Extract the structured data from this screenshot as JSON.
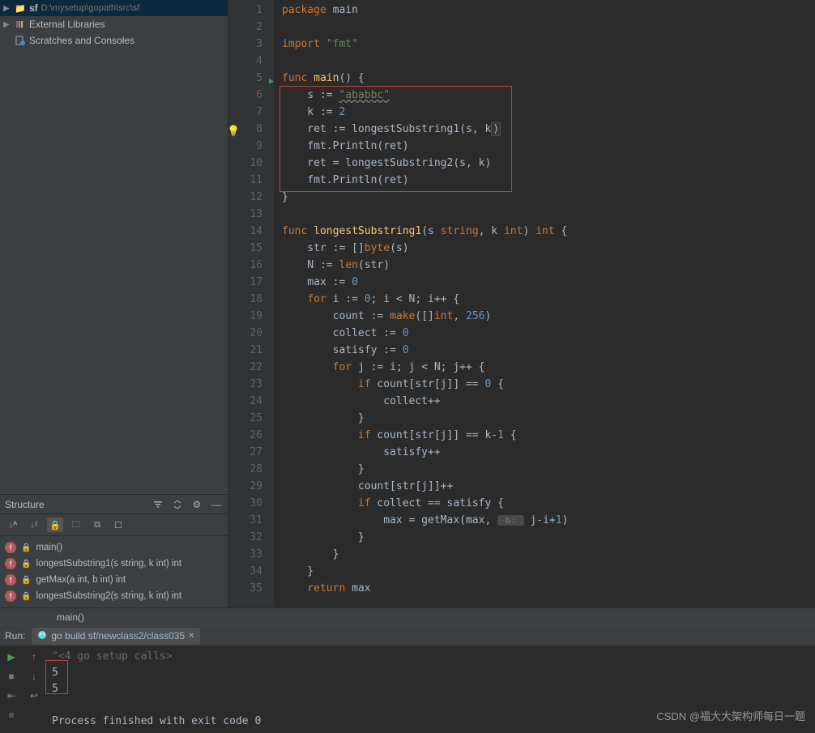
{
  "project": {
    "root_name": "sf",
    "root_path": "D:\\mysetup\\gopath\\src\\sf",
    "external_libs": "External Libraries",
    "scratches": "Scratches and Consoles"
  },
  "structure": {
    "title": "Structure",
    "items": [
      {
        "icon": "f",
        "label": "main()"
      },
      {
        "icon": "f",
        "label": "longestSubstring1(s string, k int) int"
      },
      {
        "icon": "f",
        "label": "getMax(a int, b int) int"
      },
      {
        "icon": "f",
        "label": "longestSubstring2(s string, k int) int"
      }
    ]
  },
  "code": {
    "lines": [
      {
        "n": 1,
        "seg": [
          {
            "t": "package ",
            "c": "kw"
          },
          {
            "t": "main",
            "c": "ident"
          }
        ]
      },
      {
        "n": 2,
        "seg": []
      },
      {
        "n": 3,
        "seg": [
          {
            "t": "import ",
            "c": "kw"
          },
          {
            "t": "\"fmt\"",
            "c": "str"
          }
        ]
      },
      {
        "n": 4,
        "seg": []
      },
      {
        "n": 5,
        "run": true,
        "seg": [
          {
            "t": "func ",
            "c": "kw"
          },
          {
            "t": "main",
            "c": "fn"
          },
          {
            "t": "() {",
            "c": "ident"
          }
        ]
      },
      {
        "n": 6,
        "seg": [
          {
            "t": "    s := ",
            "c": "ident"
          },
          {
            "t": "\"ababbc\"",
            "c": "str underline-wavy"
          }
        ]
      },
      {
        "n": 7,
        "seg": [
          {
            "t": "    k := ",
            "c": "ident"
          },
          {
            "t": "2",
            "c": "num"
          }
        ]
      },
      {
        "n": 8,
        "bulb": true,
        "seg": [
          {
            "t": "    ret := ",
            "c": "ident"
          },
          {
            "t": "longestSubstring1(s, k",
            "c": "ident"
          },
          {
            "t": ")",
            "c": "ident caret-bg"
          }
        ]
      },
      {
        "n": 9,
        "seg": [
          {
            "t": "    fmt.",
            "c": "ident"
          },
          {
            "t": "Println",
            "c": "ident"
          },
          {
            "t": "(ret)",
            "c": "ident"
          }
        ]
      },
      {
        "n": 10,
        "seg": [
          {
            "t": "    ret = longestSubstring2(s, k)",
            "c": "ident"
          }
        ]
      },
      {
        "n": 11,
        "seg": [
          {
            "t": "    fmt.",
            "c": "ident"
          },
          {
            "t": "Println",
            "c": "ident"
          },
          {
            "t": "(ret)",
            "c": "ident"
          }
        ]
      },
      {
        "n": 12,
        "seg": [
          {
            "t": "}",
            "c": "ident"
          }
        ]
      },
      {
        "n": 13,
        "seg": []
      },
      {
        "n": 14,
        "seg": [
          {
            "t": "func ",
            "c": "kw"
          },
          {
            "t": "longestSubstring1",
            "c": "fn"
          },
          {
            "t": "(s ",
            "c": "ident"
          },
          {
            "t": "string",
            "c": "kw"
          },
          {
            "t": ", k ",
            "c": "ident"
          },
          {
            "t": "int",
            "c": "kw"
          },
          {
            "t": ") ",
            "c": "ident"
          },
          {
            "t": "int",
            "c": "kw"
          },
          {
            "t": " {",
            "c": "ident"
          }
        ]
      },
      {
        "n": 15,
        "seg": [
          {
            "t": "    str := []",
            "c": "ident"
          },
          {
            "t": "byte",
            "c": "kw"
          },
          {
            "t": "(s)",
            "c": "ident"
          }
        ]
      },
      {
        "n": 16,
        "seg": [
          {
            "t": "    N := ",
            "c": "ident"
          },
          {
            "t": "len",
            "c": "kw"
          },
          {
            "t": "(str)",
            "c": "ident"
          }
        ]
      },
      {
        "n": 17,
        "seg": [
          {
            "t": "    max := ",
            "c": "ident"
          },
          {
            "t": "0",
            "c": "num"
          }
        ]
      },
      {
        "n": 18,
        "seg": [
          {
            "t": "    ",
            "c": "ident"
          },
          {
            "t": "for ",
            "c": "kw"
          },
          {
            "t": "i := ",
            "c": "ident"
          },
          {
            "t": "0",
            "c": "num"
          },
          {
            "t": "; i < N; i++ {",
            "c": "ident"
          }
        ]
      },
      {
        "n": 19,
        "seg": [
          {
            "t": "        count := ",
            "c": "ident"
          },
          {
            "t": "make",
            "c": "kw"
          },
          {
            "t": "([]",
            "c": "ident"
          },
          {
            "t": "int",
            "c": "kw"
          },
          {
            "t": ", ",
            "c": "ident"
          },
          {
            "t": "256",
            "c": "num"
          },
          {
            "t": ")",
            "c": "ident"
          }
        ]
      },
      {
        "n": 20,
        "seg": [
          {
            "t": "        collect := ",
            "c": "ident"
          },
          {
            "t": "0",
            "c": "num"
          }
        ]
      },
      {
        "n": 21,
        "seg": [
          {
            "t": "        satisfy := ",
            "c": "ident"
          },
          {
            "t": "0",
            "c": "num"
          }
        ]
      },
      {
        "n": 22,
        "seg": [
          {
            "t": "        ",
            "c": "ident"
          },
          {
            "t": "for ",
            "c": "kw"
          },
          {
            "t": "j := i; j < N; j++ {",
            "c": "ident"
          }
        ]
      },
      {
        "n": 23,
        "seg": [
          {
            "t": "            ",
            "c": "ident"
          },
          {
            "t": "if ",
            "c": "kw"
          },
          {
            "t": "count[str[j]] == ",
            "c": "ident"
          },
          {
            "t": "0",
            "c": "num"
          },
          {
            "t": " {",
            "c": "ident"
          }
        ]
      },
      {
        "n": 24,
        "seg": [
          {
            "t": "                collect++",
            "c": "ident"
          }
        ]
      },
      {
        "n": 25,
        "seg": [
          {
            "t": "            }",
            "c": "ident"
          }
        ]
      },
      {
        "n": 26,
        "seg": [
          {
            "t": "            ",
            "c": "ident"
          },
          {
            "t": "if ",
            "c": "kw"
          },
          {
            "t": "count[str[j]] == k-",
            "c": "ident"
          },
          {
            "t": "1",
            "c": "num"
          },
          {
            "t": " {",
            "c": "ident"
          }
        ]
      },
      {
        "n": 27,
        "seg": [
          {
            "t": "                satisfy++",
            "c": "ident"
          }
        ]
      },
      {
        "n": 28,
        "seg": [
          {
            "t": "            }",
            "c": "ident"
          }
        ]
      },
      {
        "n": 29,
        "seg": [
          {
            "t": "            count[str[j]]++",
            "c": "ident"
          }
        ]
      },
      {
        "n": 30,
        "seg": [
          {
            "t": "            ",
            "c": "ident"
          },
          {
            "t": "if ",
            "c": "kw"
          },
          {
            "t": "collect == satisfy {",
            "c": "ident"
          }
        ]
      },
      {
        "n": 31,
        "seg": [
          {
            "t": "                max = getMax(max, ",
            "c": "ident"
          },
          {
            "t": " b: ",
            "c": "param-hint"
          },
          {
            "t": " j-i+",
            "c": "ident"
          },
          {
            "t": "1",
            "c": "num"
          },
          {
            "t": ")",
            "c": "ident"
          }
        ]
      },
      {
        "n": 32,
        "seg": [
          {
            "t": "            }",
            "c": "ident"
          }
        ]
      },
      {
        "n": 33,
        "seg": [
          {
            "t": "        }",
            "c": "ident"
          }
        ]
      },
      {
        "n": 34,
        "seg": [
          {
            "t": "    }",
            "c": "ident"
          }
        ]
      },
      {
        "n": 35,
        "seg": [
          {
            "t": "    ",
            "c": "ident"
          },
          {
            "t": "return ",
            "c": "kw"
          },
          {
            "t": "max",
            "c": "ident"
          }
        ]
      }
    ]
  },
  "breadcrumb": "main()",
  "run": {
    "label": "Run:",
    "tab": "go build sf/newclass2/class035",
    "output_header": "\"<4 go setup calls>",
    "out1": "5",
    "out2": "5",
    "exit": "Process finished with exit code 0"
  },
  "watermark": "CSDN @福大大架构师每日一题"
}
